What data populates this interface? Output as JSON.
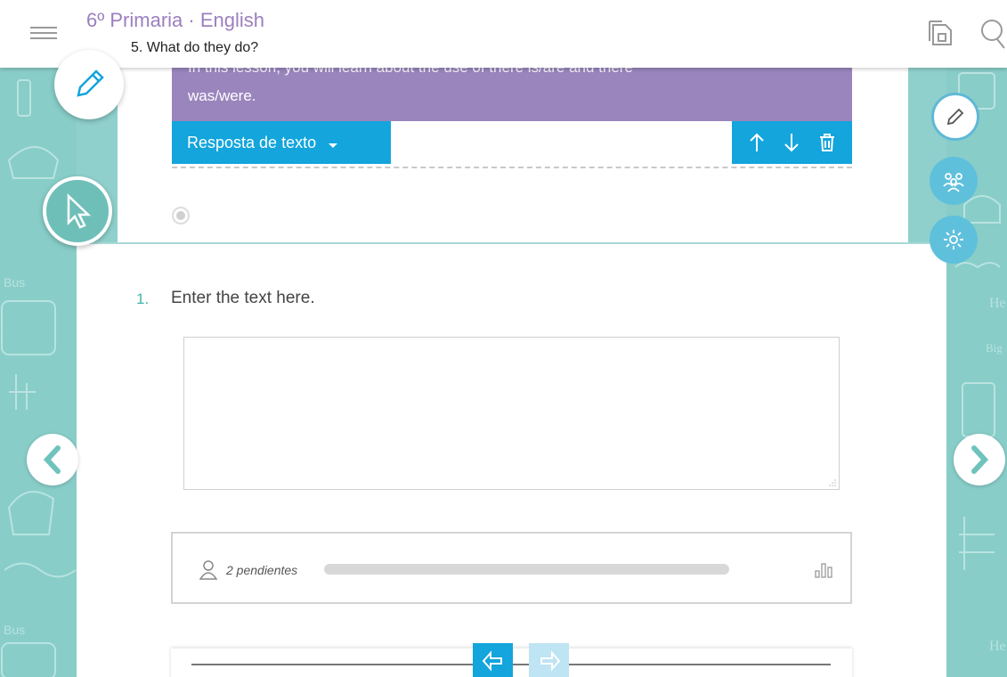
{
  "header": {
    "course_title": "6º Primaria · English",
    "unit_title": "5. What do they do?"
  },
  "lesson": {
    "intro_partial": "In this lesson, you will learn about the use of there is/are and there",
    "intro_line2": "was/were.",
    "answer_type_label": "Resposta de texto"
  },
  "question": {
    "number": "1.",
    "prompt": "Enter the text here."
  },
  "stats": {
    "pending_label": "2 pendientes",
    "progress": 0
  },
  "colors": {
    "accent_blue": "#13a5dc",
    "purple": "#9a85bd",
    "teal_background": "#88cdc8",
    "title_purple": "#9b7fbf"
  },
  "icons": [
    "menu-icon",
    "notes-icon",
    "search-icon",
    "pencil-icon",
    "cursor-icon",
    "group-icon",
    "settings-icon",
    "arrow-up-icon",
    "arrow-down-icon",
    "trash-icon",
    "user-icon",
    "bar-chart-icon",
    "undo-icon",
    "redo-icon",
    "chevron-left-icon",
    "chevron-right-icon"
  ]
}
